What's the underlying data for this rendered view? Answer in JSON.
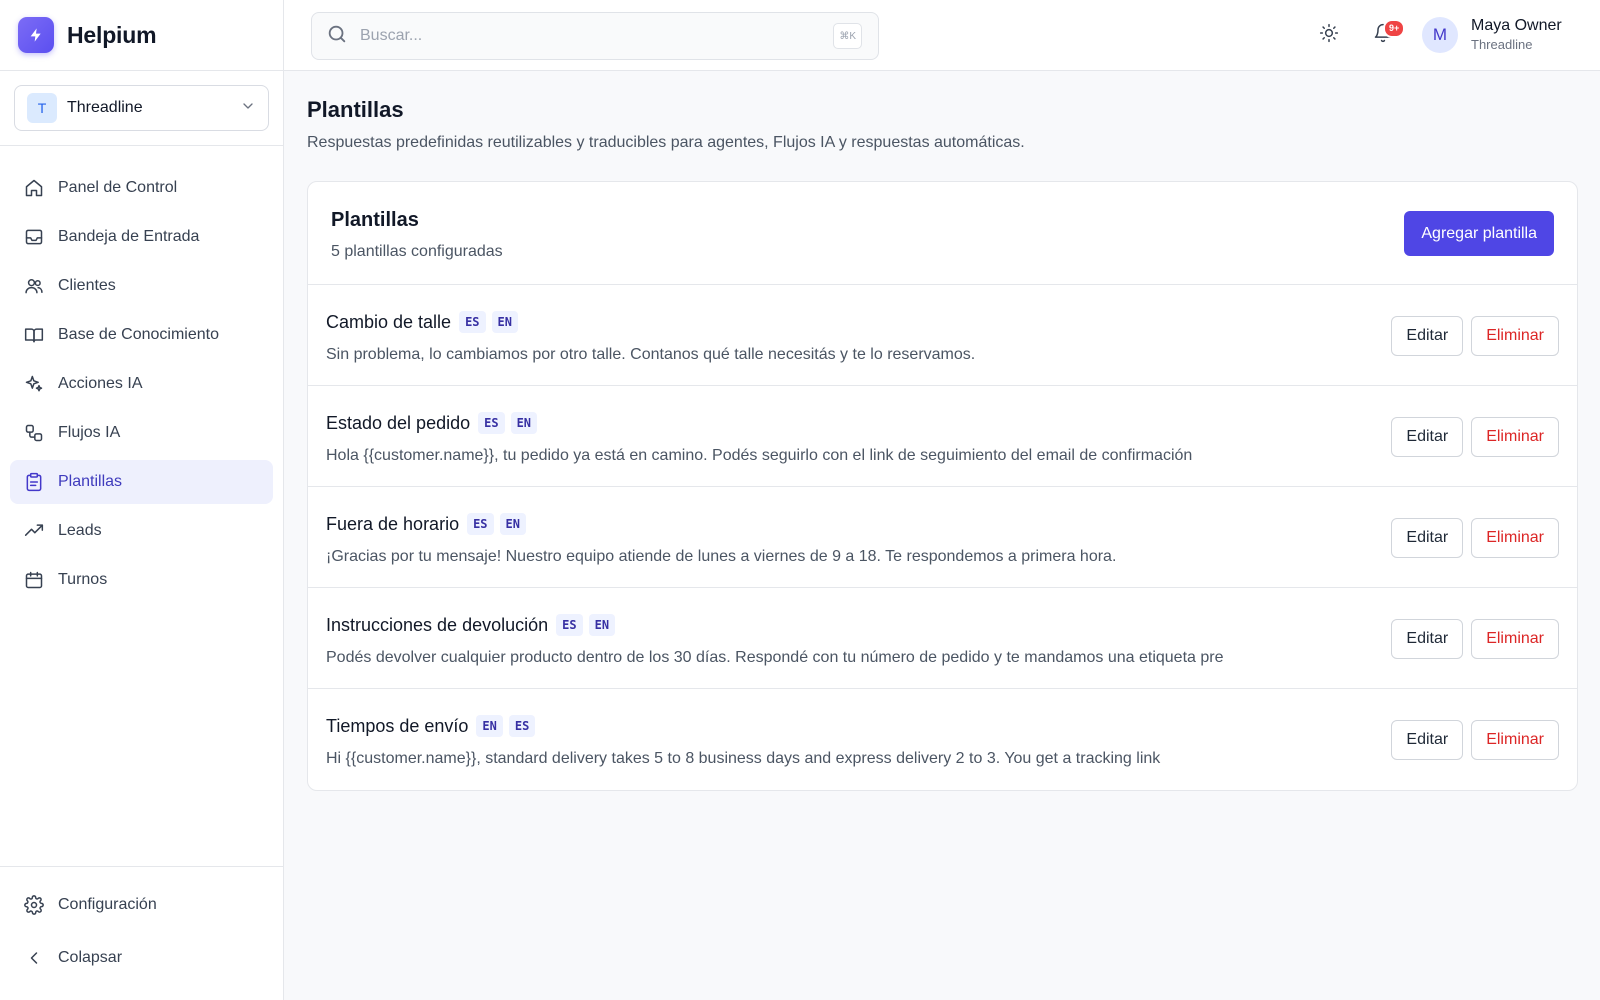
{
  "brand": {
    "name": "Helpium"
  },
  "workspace": {
    "avatar": "T",
    "name": "Threadline"
  },
  "nav": [
    {
      "label": "Panel de Control",
      "icon": "home-icon"
    },
    {
      "label": "Bandeja de Entrada",
      "icon": "inbox-icon"
    },
    {
      "label": "Clientes",
      "icon": "users-icon"
    },
    {
      "label": "Base de Conocimiento",
      "icon": "book-icon"
    },
    {
      "label": "Acciones IA",
      "icon": "sparkles-icon"
    },
    {
      "label": "Flujos IA",
      "icon": "workflow-icon"
    },
    {
      "label": "Plantillas",
      "icon": "clipboard-icon",
      "active": true
    },
    {
      "label": "Leads",
      "icon": "trending-up-icon"
    },
    {
      "label": "Turnos",
      "icon": "calendar-icon"
    }
  ],
  "sidebar_bottom": {
    "settings": "Configuración",
    "collapse": "Colapsar"
  },
  "search": {
    "placeholder": "Buscar...",
    "shortcut": "⌘K"
  },
  "notifications": {
    "count": "9+"
  },
  "user": {
    "avatar": "M",
    "name": "Maya Owner",
    "org": "Threadline"
  },
  "page": {
    "title": "Plantillas",
    "subtitle": "Respuestas predefinidas reutilizables y traducibles para agentes, Flujos IA y respuestas automáticas."
  },
  "card": {
    "title": "Plantillas",
    "subtitle": "5 plantillas configuradas",
    "add_label": "Agregar plantilla",
    "edit_label": "Editar",
    "delete_label": "Eliminar"
  },
  "templates": [
    {
      "title": "Cambio de talle",
      "langs": [
        "ES",
        "EN"
      ],
      "text": "Sin problema, lo cambiamos por otro talle. Contanos qué talle necesitás y te lo reservamos."
    },
    {
      "title": "Estado del pedido",
      "langs": [
        "ES",
        "EN"
      ],
      "text": "Hola {{customer.name}}, tu pedido ya está en camino. Podés seguirlo con el link de seguimiento del email de confirmación"
    },
    {
      "title": "Fuera de horario",
      "langs": [
        "ES",
        "EN"
      ],
      "text": "¡Gracias por tu mensaje! Nuestro equipo atiende de lunes a viernes de 9 a 18. Te respondemos a primera hora."
    },
    {
      "title": "Instrucciones de devolución",
      "langs": [
        "ES",
        "EN"
      ],
      "text": "Podés devolver cualquier producto dentro de los 30 días. Respondé con tu número de pedido y te mandamos una etiqueta pre"
    },
    {
      "title": "Tiempos de envío",
      "langs": [
        "EN",
        "ES"
      ],
      "text": "Hi {{customer.name}}, standard delivery takes 5 to 8 business days and express delivery 2 to 3. You get a tracking link"
    }
  ],
  "colors": {
    "accent": "#4f46e5",
    "active_bg": "#eef0fd",
    "danger": "#dc2626"
  }
}
